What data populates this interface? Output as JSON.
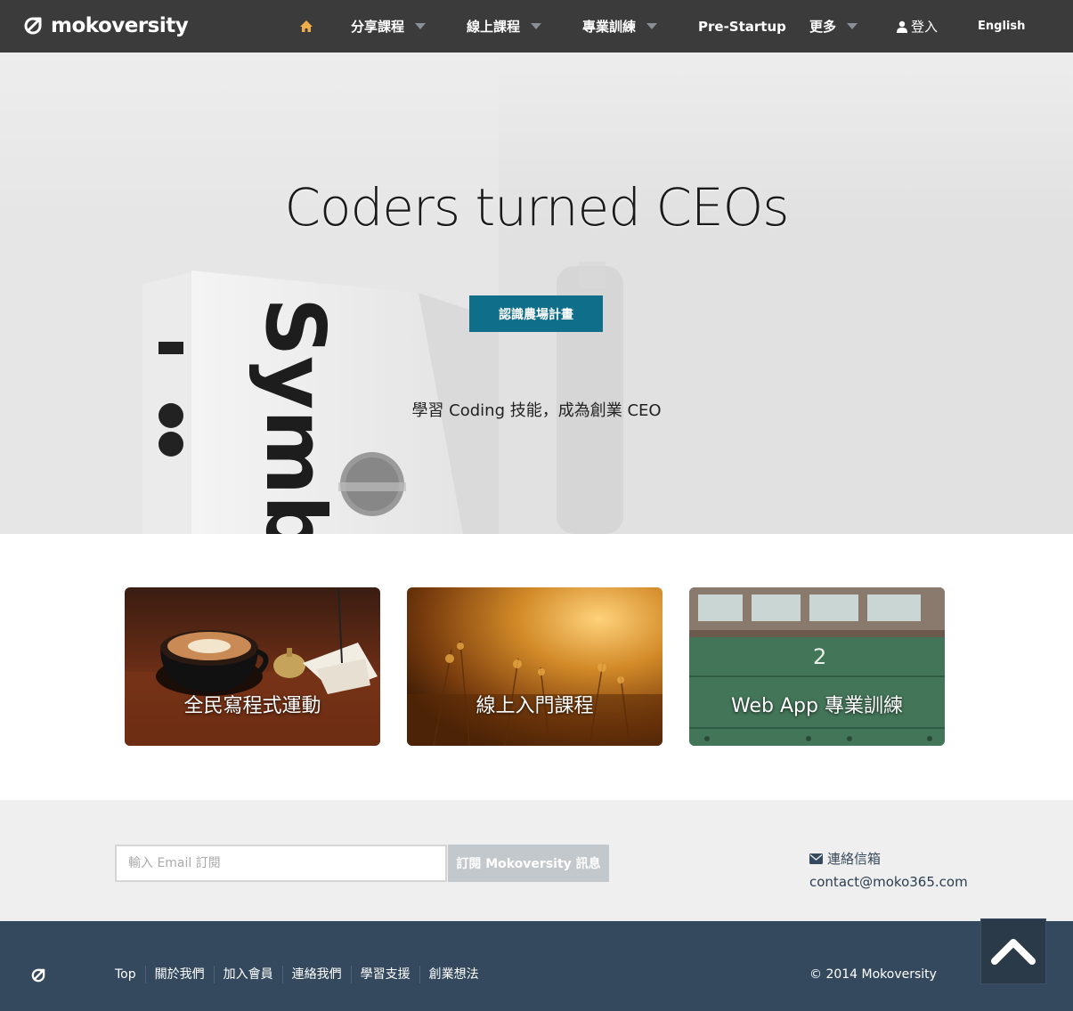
{
  "nav": {
    "brand": "mokoversity",
    "home_icon": "home-icon",
    "items": [
      {
        "label": "分享課程",
        "dropdown": true
      },
      {
        "label": "線上課程",
        "dropdown": true
      },
      {
        "label": "專業訓練",
        "dropdown": true
      },
      {
        "label": "Pre-Startup",
        "dropdown": false
      },
      {
        "label": "更多",
        "dropdown": true
      }
    ],
    "login": "登入",
    "language": "English",
    "accent_color": "#f0ad4e",
    "bg_color": "#3b3b3b"
  },
  "hero": {
    "title": "Coders turned CEOs",
    "button": "認識農場計畫",
    "subtitle": "學習 Coding 技能，成為創業 CEO",
    "button_color": "#0f6f8a"
  },
  "cards": [
    {
      "label": "全民寫程式運動"
    },
    {
      "label": "線上入門課程"
    },
    {
      "label": "Web App 專業訓練"
    }
  ],
  "subscribe": {
    "placeholder": "輸入 Email 訂閱",
    "button": "訂閱 Mokoversity 訊息",
    "contact_label": "連絡信箱",
    "contact_email": "contact@moko365.com"
  },
  "footer": {
    "links": [
      "Top",
      "關於我們",
      "加入會員",
      "連絡我們",
      "學習支援",
      "創業想法"
    ],
    "copyright": "© 2014 Mokoversity",
    "bg_color": "#34495e"
  }
}
